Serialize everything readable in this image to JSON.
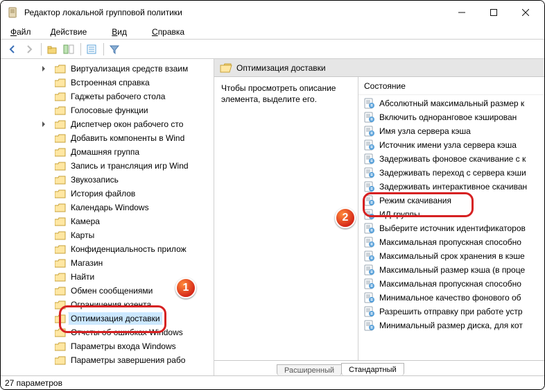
{
  "window": {
    "title": "Редактор локальной групповой политики"
  },
  "menu": {
    "file": "Файл",
    "action": "Действие",
    "view": "Вид",
    "help": "Справка"
  },
  "tree": {
    "items": [
      {
        "label": "Виртуализация средств взаим",
        "expander": true
      },
      {
        "label": "Встроенная справка"
      },
      {
        "label": "Гаджеты рабочего стола"
      },
      {
        "label": "Голосовые функции"
      },
      {
        "label": "Диспетчер окон рабочего сто",
        "expander": true
      },
      {
        "label": "Добавить компоненты в Wind"
      },
      {
        "label": "Домашняя группа"
      },
      {
        "label": "Запись и трансляция игр Wind"
      },
      {
        "label": "Звукозапись"
      },
      {
        "label": "История файлов"
      },
      {
        "label": "Календарь Windows"
      },
      {
        "label": "Камера"
      },
      {
        "label": "Карты"
      },
      {
        "label": "Конфиденциальность прилож"
      },
      {
        "label": "Магазин"
      },
      {
        "label": "Найти"
      },
      {
        "label": "Обмен сообщениями"
      },
      {
        "label": "Ограничения юзента"
      },
      {
        "label": "Оптимизация доставки",
        "selected": true
      },
      {
        "label": "Отчеты об ошибках Windows"
      },
      {
        "label": "Параметры входа Windows"
      },
      {
        "label": "Параметры завершения рабо"
      }
    ]
  },
  "header": {
    "title": "Оптимизация доставки"
  },
  "description": "Чтобы просмотреть описание элемента, выделите его.",
  "list": {
    "column": "Состояние",
    "items": [
      "Абсолютный максимальный размер к",
      "Включить одноранговое кэширован",
      "Имя узла сервера кэша",
      "Источник имени узла сервера кэша",
      "Задерживать фоновое скачивание с к",
      "Задерживать переход с сервера кэши",
      "Задерживать интерактивное скачиван",
      "Режим скачивания",
      "ИД группы",
      "Выберите источник идентификаторов",
      "Максимальная пропускная способно",
      "Максимальный срок хранения в кэше",
      "Максимальный размер кэша (в проце",
      "Максимальная пропускная способно",
      "Минимальное качество фонового об",
      "Разрешить отправку при работе устр",
      "Минимальный размер диска, для кот"
    ]
  },
  "tabs": {
    "extended": "Расширенный",
    "standard": "Стандартный"
  },
  "status": "27 параметров",
  "annotations": {
    "b1": "1",
    "b2": "2"
  }
}
